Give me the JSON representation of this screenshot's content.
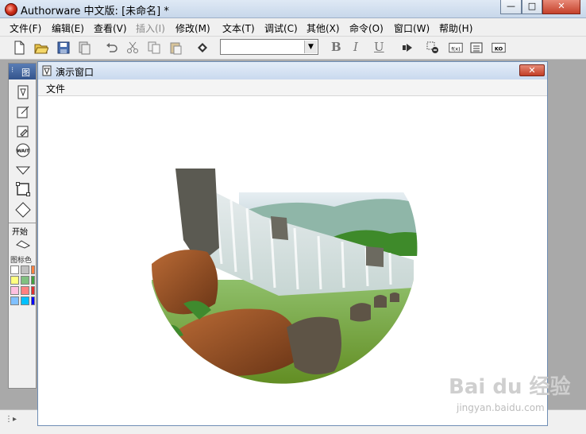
{
  "window": {
    "title": "Authorware 中文版: [未命名] *",
    "min_label": "—",
    "max_label": "□",
    "close_label": "✕"
  },
  "menubar": {
    "items": [
      {
        "label": "文件(F)"
      },
      {
        "label": "编辑(E)"
      },
      {
        "label": "查看(V)"
      },
      {
        "label": "插入(I)",
        "disabled": true
      },
      {
        "label": "修改(M)"
      },
      {
        "label": "文本(T)"
      },
      {
        "label": "调试(C)"
      },
      {
        "label": "其他(X)"
      },
      {
        "label": "命令(O)"
      },
      {
        "label": "窗口(W)"
      },
      {
        "label": "帮助(H)"
      }
    ]
  },
  "toolbar": {
    "font_combo_value": "",
    "bold": "B",
    "italic": "I",
    "underline": "U",
    "fx_label": "f(x)",
    "ko_label": "KO"
  },
  "icon_palette": {
    "title": "图",
    "start_label": "开始",
    "colors_label": "图标色",
    "swatches": [
      "#ffffff",
      "#c0c0c0",
      "#ffc0c0",
      "#ffff80",
      "#c0ffc0",
      "#80c080",
      "#ffc0e0",
      "#ff8080",
      "#e08080",
      "#80c0ff",
      "#00c0ff",
      "#0000ff"
    ]
  },
  "presentation_window": {
    "title": "演示窗口",
    "menu_file": "文件"
  },
  "watermark": {
    "logo": "Bai du 经验",
    "url": "jingyan.baidu.com"
  },
  "colors": {
    "title_gradient_top": "#dfe9f5",
    "workspace": "#a9a9a9",
    "close_red": "#c4412b"
  }
}
